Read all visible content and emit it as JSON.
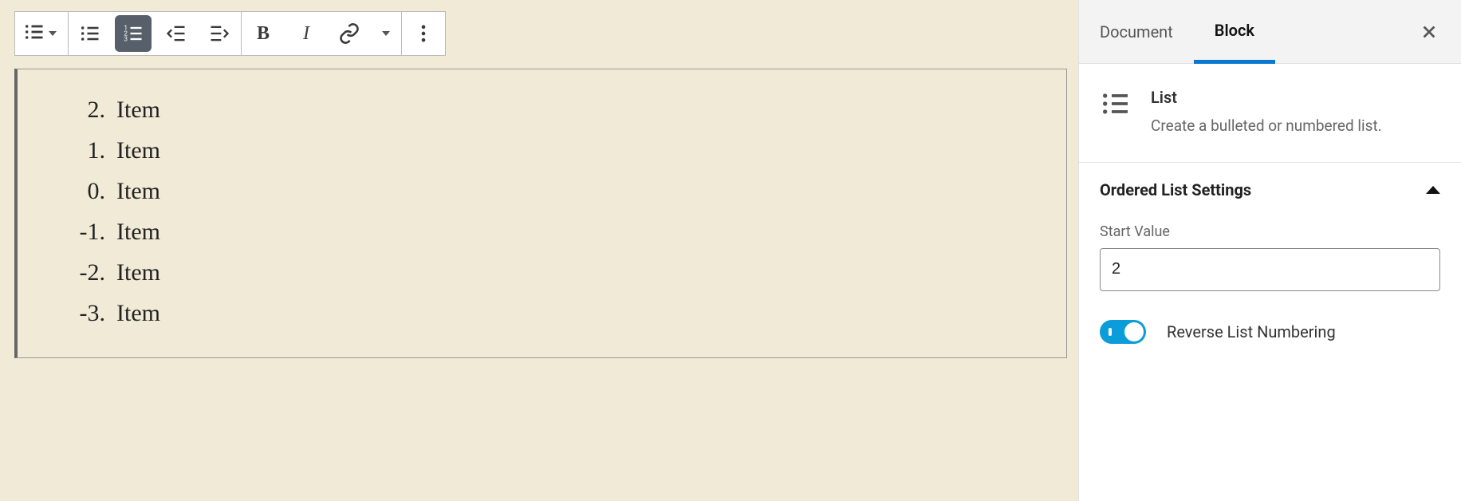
{
  "toolbar": {
    "block_type": "list",
    "list_style": {
      "unordered": false,
      "ordered": true
    }
  },
  "list": {
    "start": 2,
    "reversed": true,
    "items": [
      {
        "num": "2.",
        "text": "Item"
      },
      {
        "num": "1.",
        "text": "Item"
      },
      {
        "num": "0.",
        "text": "Item"
      },
      {
        "num": "-1.",
        "text": "Item"
      },
      {
        "num": "-2.",
        "text": "Item"
      },
      {
        "num": "-3.",
        "text": "Item"
      }
    ]
  },
  "sidebar": {
    "tabs": {
      "document": "Document",
      "block": "Block",
      "active": "block"
    },
    "block_card": {
      "title": "List",
      "description": "Create a bulleted or numbered list."
    },
    "panel": {
      "title": "Ordered List Settings",
      "start_label": "Start Value",
      "start_value": "2",
      "reverse_label": "Reverse List Numbering",
      "reverse_on": true
    }
  }
}
